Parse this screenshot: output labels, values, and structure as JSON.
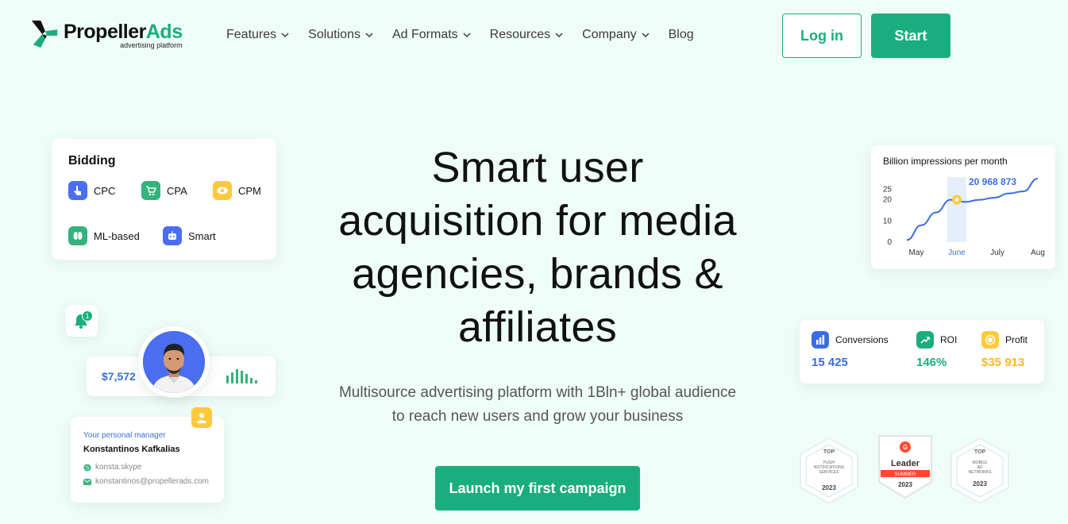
{
  "header": {
    "logo_main": "Propeller",
    "logo_accent": "Ads",
    "logo_tagline": "advertising platform",
    "nav": [
      {
        "label": "Features",
        "dropdown": true
      },
      {
        "label": "Solutions",
        "dropdown": true
      },
      {
        "label": "Ad Formats",
        "dropdown": true
      },
      {
        "label": "Resources",
        "dropdown": true
      },
      {
        "label": "Company",
        "dropdown": true
      },
      {
        "label": "Blog",
        "dropdown": false
      }
    ],
    "login_label": "Log in",
    "start_label": "Start"
  },
  "hero": {
    "title_lines": [
      "Smart user",
      "acquisition for media",
      "agencies, brands &",
      "affiliates"
    ],
    "subtitle_lines": [
      "Multisource advertising platform with 1Bln+ global audience",
      "to reach new users and grow your business"
    ],
    "cta_label": "Launch my first campaign"
  },
  "bidding": {
    "title": "Bidding",
    "items": [
      {
        "label": "CPC",
        "icon": "pointer-icon",
        "color": "#4a6ef0"
      },
      {
        "label": "CPA",
        "icon": "cart-icon",
        "color": "#34b37c"
      },
      {
        "label": "CPM",
        "icon": "eye-icon",
        "color": "#ffc93c"
      },
      {
        "label": "ML-based",
        "icon": "brain-icon",
        "color": "#34b37c"
      },
      {
        "label": "Smart",
        "icon": "robot-icon",
        "color": "#4a6ef0"
      }
    ]
  },
  "notification": {
    "count": "1"
  },
  "earnings": {
    "amount": "$7,572"
  },
  "manager": {
    "label": "Your personal manager",
    "name": "Konstantinos Kafkalias",
    "skype": "konsta.skype",
    "email": "konstantinos@propellerads.com"
  },
  "impressions": {
    "title": "Billion impressions per month",
    "highlight": "20 968 873"
  },
  "chart_data": {
    "type": "line",
    "title": "Billion impressions per month",
    "categories": [
      "May",
      "June",
      "July",
      "Aug"
    ],
    "highlight_category": "June",
    "y_ticks": [
      0,
      10,
      20,
      25
    ],
    "ylim": [
      0,
      30
    ],
    "series": [
      {
        "values": [
          1,
          8,
          14,
          20,
          19,
          20,
          21,
          23,
          24,
          30
        ]
      }
    ],
    "annotation": "20 968 873",
    "grid": true
  },
  "stats": [
    {
      "label": "Conversions",
      "value": "15 425",
      "icon": "bar-chart-icon",
      "color": "#3b6de0"
    },
    {
      "label": "ROI",
      "value": "146%",
      "icon": "trend-up-icon",
      "color": "#1aae7e"
    },
    {
      "label": "Profit",
      "value": "$35 913",
      "icon": "coin-icon",
      "color": "#ffb627"
    }
  ],
  "awards": [
    {
      "top": "TOP",
      "lines": [
        "PUSH",
        "NOTIFICATIONS",
        "SERVICES"
      ],
      "year": "2023"
    },
    {
      "top": "",
      "lines": [
        "Leader",
        "SUMMER"
      ],
      "year": "2023"
    },
    {
      "top": "TOP",
      "lines": [
        "MOBILE",
        "AD",
        "NETWORKS"
      ],
      "year": "2023"
    }
  ]
}
